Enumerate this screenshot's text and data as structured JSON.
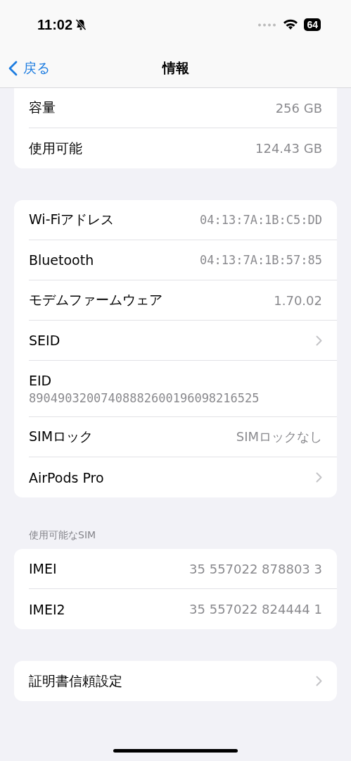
{
  "status_bar": {
    "time": "11:02",
    "silent": true,
    "battery": "64"
  },
  "nav": {
    "back": "戻る",
    "title": "情報"
  },
  "groups": [
    {
      "rows": [
        {
          "kind": "value",
          "label": "容量",
          "value": "256 GB"
        },
        {
          "kind": "value",
          "label": "使用可能",
          "value": "124.43 GB"
        }
      ]
    },
    {
      "rows": [
        {
          "kind": "value",
          "label": "Wi-Fiアドレス",
          "value": "04:13:7A:1B:C5:DD",
          "mono": true
        },
        {
          "kind": "value",
          "label": "Bluetooth",
          "value": "04:13:7A:1B:57:85",
          "mono": true
        },
        {
          "kind": "value",
          "label": "モデムファームウェア",
          "value": "1.70.02"
        },
        {
          "kind": "link",
          "label": "SEID"
        },
        {
          "kind": "stacked",
          "label": "EID",
          "value": "89049032007408882600196098216525",
          "mono": true
        },
        {
          "kind": "value",
          "label": "SIMロック",
          "value": "SIMロックなし"
        },
        {
          "kind": "link",
          "label": "AirPods Pro"
        }
      ]
    },
    {
      "header": "使用可能なSIM",
      "rows": [
        {
          "kind": "value",
          "label": "IMEI",
          "value": "35 557022 878803 3"
        },
        {
          "kind": "value",
          "label": "IMEI2",
          "value": "35 557022 824444 1"
        }
      ]
    },
    {
      "rows": [
        {
          "kind": "link",
          "label": "証明書信頼設定"
        }
      ]
    }
  ]
}
